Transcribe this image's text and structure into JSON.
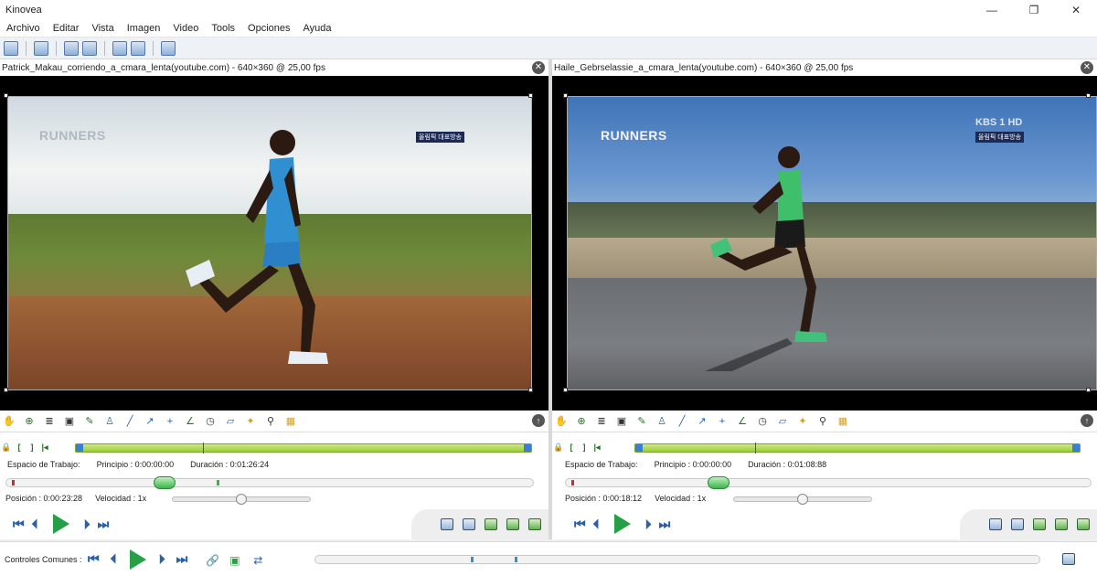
{
  "window": {
    "title": "Kinovea",
    "min_label": "—",
    "max_label": "❐",
    "close_label": "✕"
  },
  "menu": [
    "Archivo",
    "Editar",
    "Vista",
    "Imagen",
    "Video",
    "Tools",
    "Opciones",
    "Ayuda"
  ],
  "left": {
    "file_header": "Patrick_Makau_corriendo_a_cmara_lenta(youtube.com) - 640×360 @ 25,00 fps",
    "overlay_logo": "RUNNERS",
    "overlay_badge": "올림픽 대표방송",
    "workspace_label": "Espacio de Trabajo:",
    "start_label": "Principio : 0:00:00:00",
    "duration_label": "Duración : 0:01:26:24",
    "position_label": "Posición : 0:00:23:28",
    "speed_label": "Velocidad : 1x",
    "playhead_fraction": 0.28,
    "speed_fraction": 0.5
  },
  "right": {
    "file_header": "Haile_Gebrselassie_a_cmara_lenta(youtube.com) - 640×360 @ 25,00 fps",
    "overlay_logo": "RUNNERS",
    "overlay_kbs": "KBS 1 HD",
    "overlay_badge": "올림픽 대표방송",
    "workspace_label": "Espacio de Trabajo:",
    "start_label": "Principio : 0:00:00:00",
    "duration_label": "Duración : 0:01:08:88",
    "position_label": "Posición : 0:00:18:12",
    "speed_label": "Velocidad : 1x",
    "playhead_fraction": 0.27,
    "speed_fraction": 0.5
  },
  "common": {
    "label": "Controles Comunes :",
    "marker_fractions": [
      0.215,
      0.275
    ]
  },
  "colors": {
    "workspace_green": "#9acd32",
    "play_green": "#25a046",
    "transport_blue": "#2b5fa8"
  }
}
